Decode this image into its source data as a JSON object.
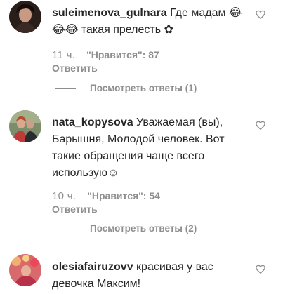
{
  "comments": [
    {
      "username": "suleimenova_gulnara",
      "text": " Где мадам 😂😂😂 такая прелесть ✿",
      "time": "11 ч.",
      "likes": "\"Нравится\": 87",
      "reply_label": "Ответить",
      "view_replies": "Посмотреть ответы (1)",
      "avatar_colors": [
        "#1a1412",
        "#b08070"
      ]
    },
    {
      "username": "nata_kopysova",
      "text": " Уважаемая (вы), Барышня, Молодой человек. Вот такие обращения чаще всего использую☺",
      "time": "10 ч.",
      "likes": "\"Нравится\": 54",
      "reply_label": "Ответить",
      "view_replies": "Посмотреть ответы (2)",
      "avatar_colors": [
        "#6e7c5a",
        "#c04040"
      ]
    },
    {
      "username": "olesiafairuzovv",
      "text": " красивая у вас девочка Максим!",
      "avatar_colors": [
        "#c8505a",
        "#e8a060"
      ]
    }
  ]
}
